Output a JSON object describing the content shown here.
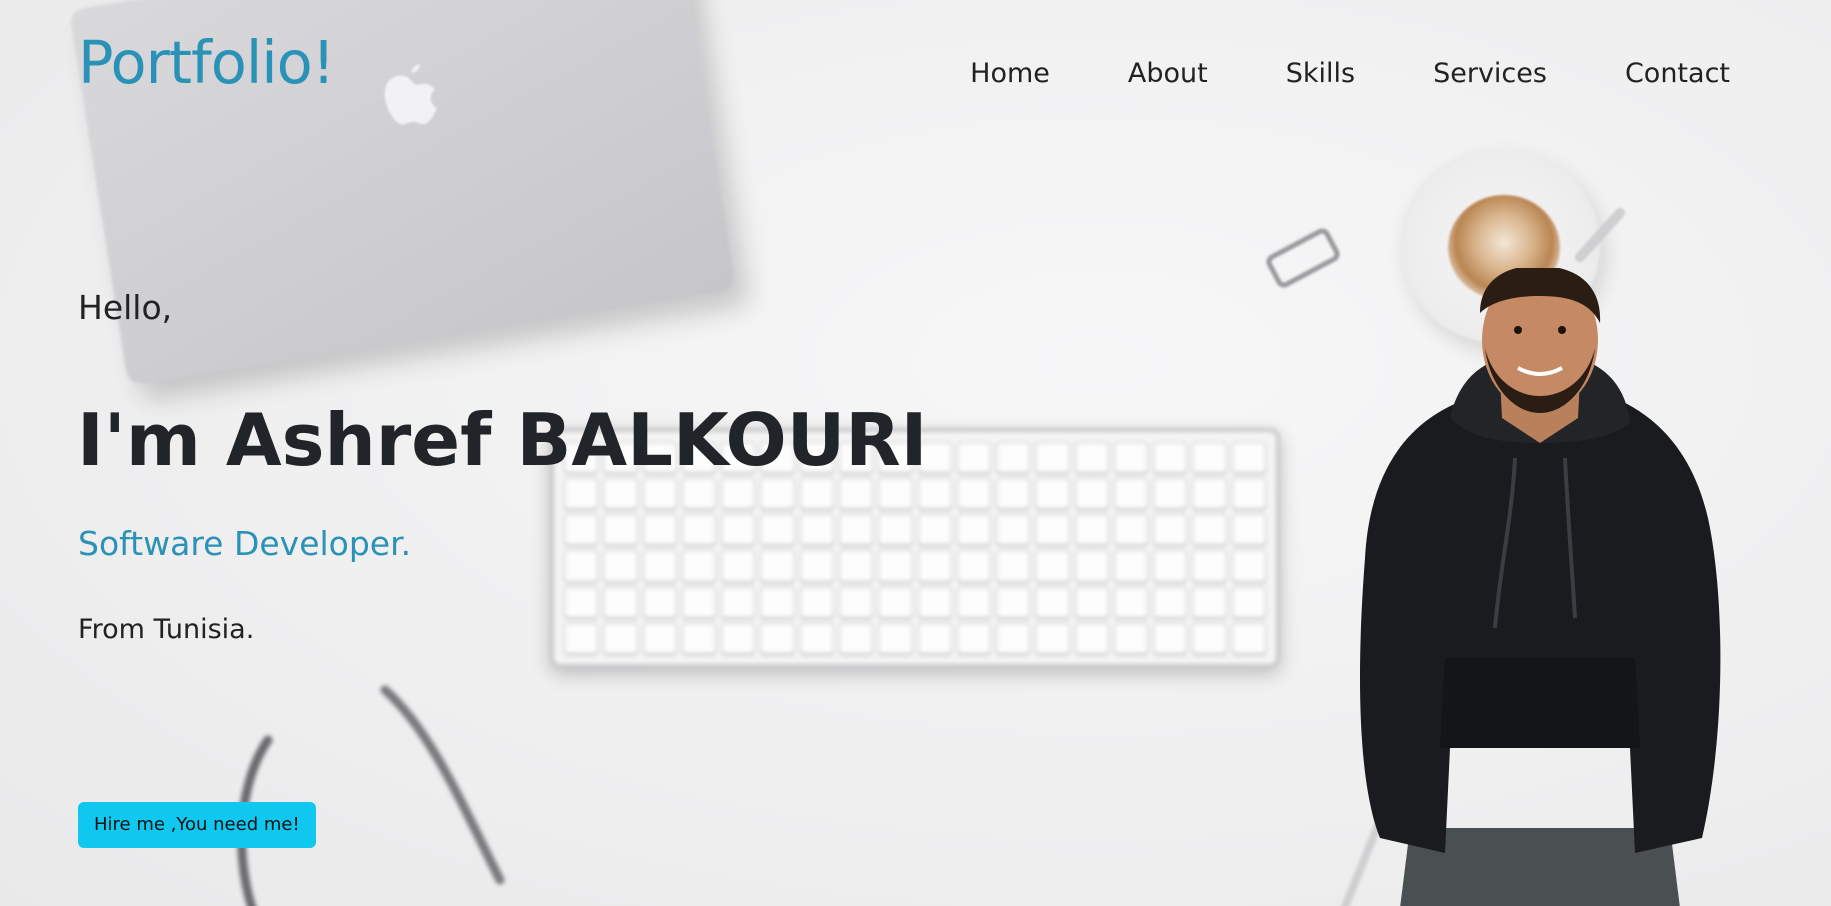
{
  "header": {
    "brand": "Portfolio!",
    "nav": [
      {
        "label": "Home"
      },
      {
        "label": "About"
      },
      {
        "label": "Skills"
      },
      {
        "label": "Services"
      },
      {
        "label": "Contact"
      }
    ]
  },
  "hero": {
    "greeting": "Hello,",
    "headline": "I'm Ashref BALKOURI",
    "role": "Software Developer.",
    "origin": "From Tunisia.",
    "cta_label": "Hire me ,You need me!"
  },
  "colors": {
    "brand_accent": "#2a92b7",
    "button_bg": "#10c8ef",
    "text_dark": "#212529",
    "background": "#f1f1f2"
  },
  "icons": [
    "apple-logo-icon"
  ]
}
